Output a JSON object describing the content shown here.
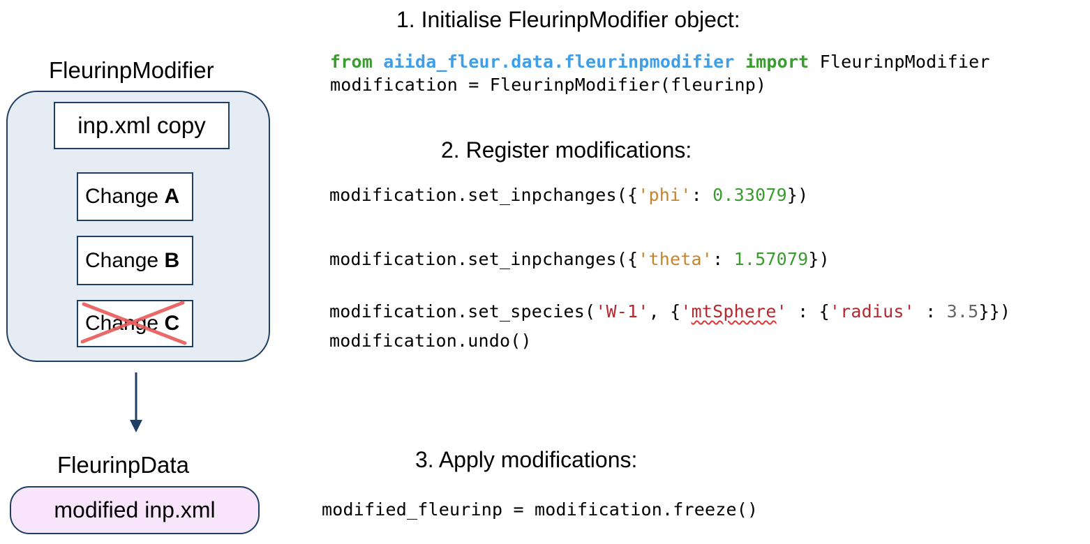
{
  "left": {
    "modifier_label": "FleurinpModifier",
    "copy_box": "inp.xml copy",
    "changes": [
      {
        "prefix": "Change ",
        "letter": "A"
      },
      {
        "prefix": "Change ",
        "letter": "B"
      },
      {
        "prefix": "Change ",
        "letter": "C"
      }
    ],
    "data_label": "FleurinpData",
    "data_box": "modified inp.xml"
  },
  "step1": {
    "title": "1. Initialise FleurinpModifier object:",
    "line1": {
      "kw_from": "from",
      "module": "aiida_fleur.data.fleurinpmodifier",
      "kw_import": "import",
      "name": " FleurinpModifier"
    },
    "line2": "modification = FleurinpModifier(fleurinp)"
  },
  "step2": {
    "title": "2. Register modifications:",
    "line_phi": {
      "pre": "modification.set_inpchanges({",
      "key": "'phi'",
      "sep": ": ",
      "value": "0.33079",
      "post": "})"
    },
    "line_theta": {
      "pre": "modification.set_inpchanges({",
      "key": "'theta'",
      "sep": ": ",
      "value": "1.57079",
      "post": "})"
    },
    "line_species": {
      "pre": "modification.set_species(",
      "species": "'W-1'",
      "mid1": ", {",
      "q1": "'",
      "key1": "mtSphere",
      "q2": "'",
      "mid2": " : {",
      "key2": "'radius'",
      "mid3": " : ",
      "value": "3.5",
      "post": "}})"
    },
    "line_undo": "modification.undo()"
  },
  "step3": {
    "title": "3. Apply modifications:",
    "line": "modified_fleurinp = modification.freeze()"
  },
  "colors": {
    "box_border": "#1f3f63",
    "modifier_fill": "#e5ecf4",
    "data_fill": "#f8e4fb",
    "cross": "#e85a5a",
    "keyword": "#3a9c2e",
    "module": "#3f9ee6"
  }
}
